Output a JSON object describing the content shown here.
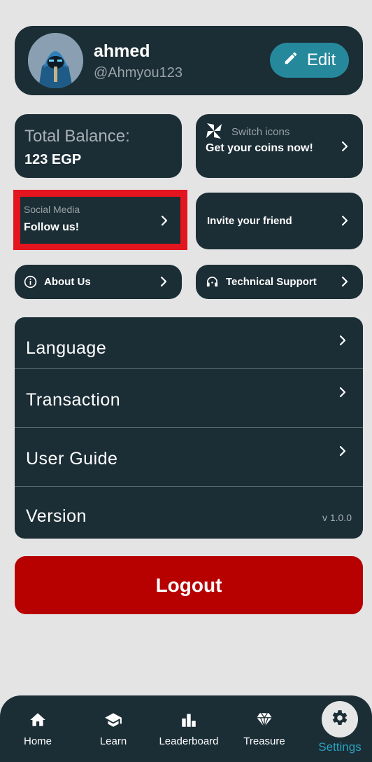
{
  "profile": {
    "name": "ahmed",
    "handle": "@Ahmyou123",
    "edit_label": "Edit"
  },
  "balance": {
    "label": "Total Balance:",
    "value": "123 EGP"
  },
  "switch_icons": {
    "label": "Switch icons",
    "subtitle": "Get your coins now!"
  },
  "social": {
    "label": "Social Media",
    "subtitle": "Follow us!"
  },
  "invite": {
    "label": "Invite your friend"
  },
  "about": {
    "label": "About Us"
  },
  "support": {
    "label": "Technical Support"
  },
  "menu": {
    "items": [
      {
        "label": "Language"
      },
      {
        "label": "Transaction"
      },
      {
        "label": "User Guide"
      },
      {
        "label": "Version",
        "value": "v 1.0.0"
      }
    ]
  },
  "logout_label": "Logout",
  "nav": {
    "items": [
      {
        "label": "Home",
        "icon": "home-icon"
      },
      {
        "label": "Learn",
        "icon": "graduation-cap-icon"
      },
      {
        "label": "Leaderboard",
        "icon": "bar-chart-icon"
      },
      {
        "label": "Treasure",
        "icon": "diamond-icon"
      },
      {
        "label": "Settings",
        "icon": "gear-icon",
        "active": true
      }
    ]
  },
  "colors": {
    "background": "#e4e4e4",
    "card": "#1b2d35",
    "accent": "#26889b",
    "logout": "#b70000",
    "highlight": "#e3151f",
    "active_nav": "#29a3c0"
  }
}
